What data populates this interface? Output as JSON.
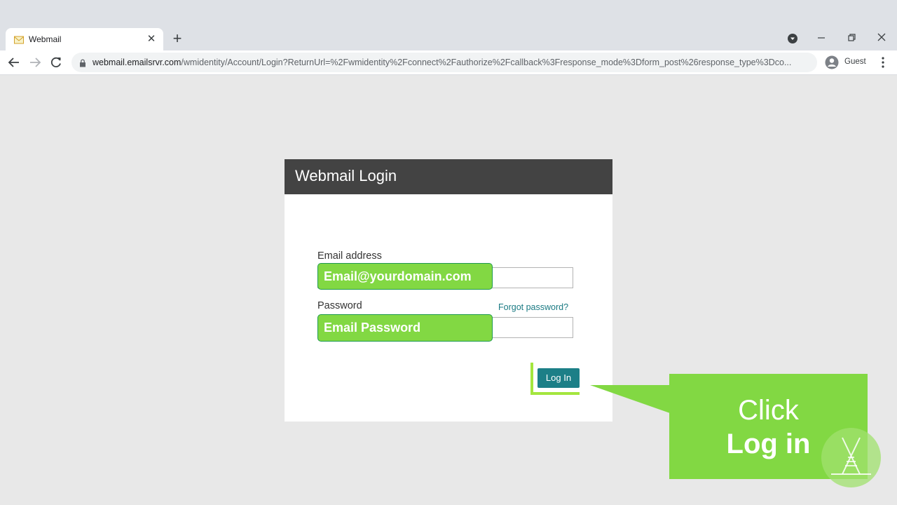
{
  "browser": {
    "tab_title": "Webmail",
    "url_host": "webmail.emailsrvr.com",
    "url_path": "/wmidentity/Account/Login?ReturnUrl=%2Fwmidentity%2Fconnect%2Fauthorize%2Fcallback%3Fresponse_mode%3Dform_post%26response_type%3Dco...",
    "profile_label": "Guest",
    "window_buttons": [
      "minimize-icon",
      "restore-icon",
      "close-icon"
    ]
  },
  "login": {
    "title": "Webmail Login",
    "email_label": "Email address",
    "email_value": "",
    "password_label": "Password",
    "password_value": "",
    "forgot_link": "Forgot password?",
    "submit_label": "Log In"
  },
  "overlay": {
    "email_hint": "Email@yourdomain.com",
    "password_hint": "Email Password",
    "callout_line1": "Click",
    "callout_line2": "Log in",
    "accent_color": "#82d843"
  }
}
